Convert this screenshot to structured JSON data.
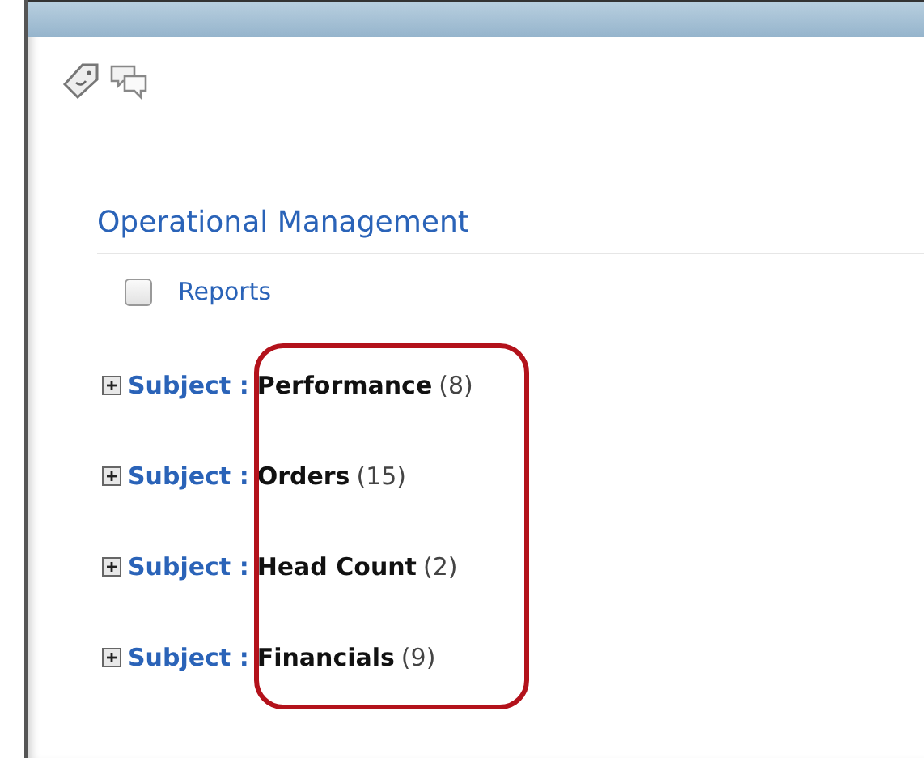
{
  "section": {
    "title": "Operational Management"
  },
  "reports": {
    "label": "Reports",
    "checked": false
  },
  "subjects": [
    {
      "label": "Subject :",
      "name": "Performance",
      "count": "(8)",
      "expanded": false
    },
    {
      "label": "Subject :",
      "name": "Orders",
      "count": "(15)",
      "expanded": false
    },
    {
      "label": "Subject :",
      "name": "Head Count",
      "count": "(2)",
      "expanded": false
    },
    {
      "label": "Subject :",
      "name": "Financials",
      "count": "(9)",
      "expanded": false
    }
  ]
}
